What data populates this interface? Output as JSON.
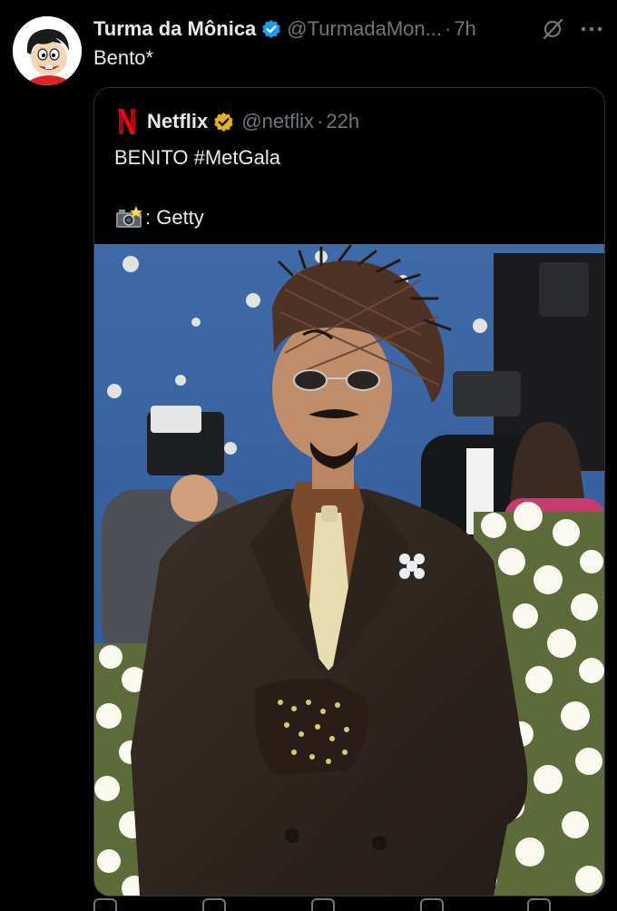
{
  "tweet": {
    "author_name": "Turma da Mônica",
    "author_handle": "@TurmadaMon...",
    "separator": "·",
    "time": "7h",
    "text": "Bento*",
    "avatar_icon": "monica-avatar",
    "verified_color": "#1d9bf0"
  },
  "quote": {
    "author_name": "Netflix",
    "author_handle": "@netflix",
    "separator": "·",
    "time": "22h",
    "line1": "BENITO #MetGala",
    "line2": ": Getty",
    "logo_icon": "netflix-logo",
    "verified_color": "#e8b01f",
    "camera_icon": "camera-flash-icon",
    "image_alt": "Man in brown suit, woven hat, sunglasses and jeweled glove at the Met Gala"
  },
  "theme": {
    "background": "#000000",
    "text": "#e7e9ea",
    "muted": "#71767b",
    "border": "#2f3336",
    "netflix_red": "#e50914"
  }
}
